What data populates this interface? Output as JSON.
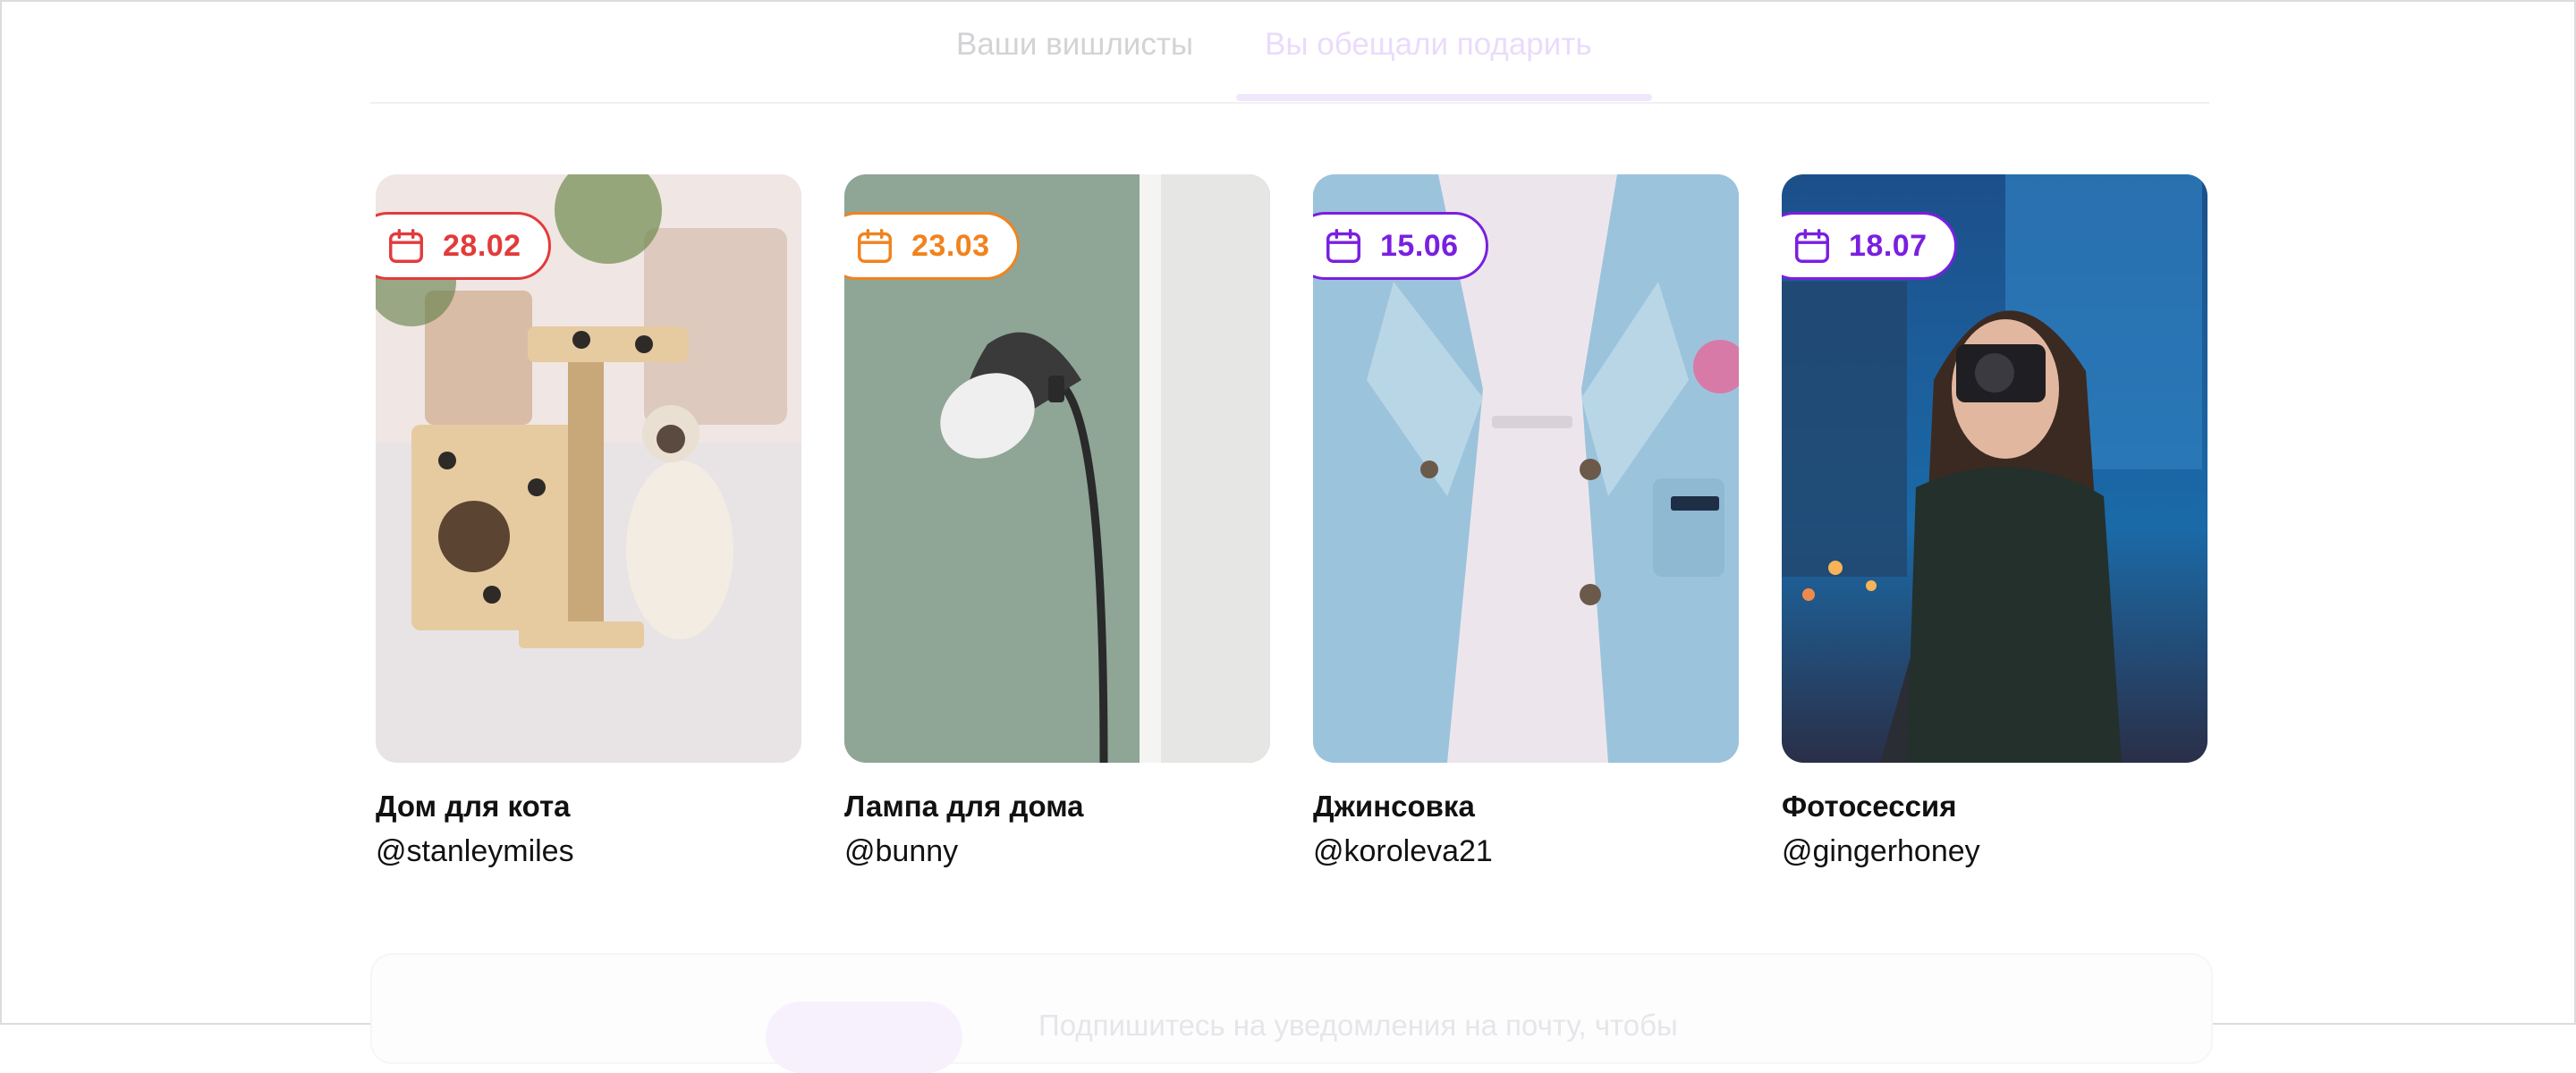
{
  "tabs": {
    "wishlists": "Ваши вишлисты",
    "promised": "Вы обещали подарить"
  },
  "cards": [
    {
      "date": "28.02",
      "title": "Дом для кота",
      "user": "@stanleymiles",
      "accent": "#e23b3b"
    },
    {
      "date": "23.03",
      "title": "Лампа для дома",
      "user": "@bunny",
      "accent": "#f0831e"
    },
    {
      "date": "15.06",
      "title": "Джинсовка",
      "user": "@koroleva21",
      "accent": "#7a1fe0"
    },
    {
      "date": "18.07",
      "title": "Фотосессия",
      "user": "@gingerhoney",
      "accent": "#7a1fe0"
    }
  ],
  "icons": {
    "date": "calendar-icon"
  },
  "banner": {
    "text": "Подпишитесь на уведомления на почту, чтобы"
  }
}
